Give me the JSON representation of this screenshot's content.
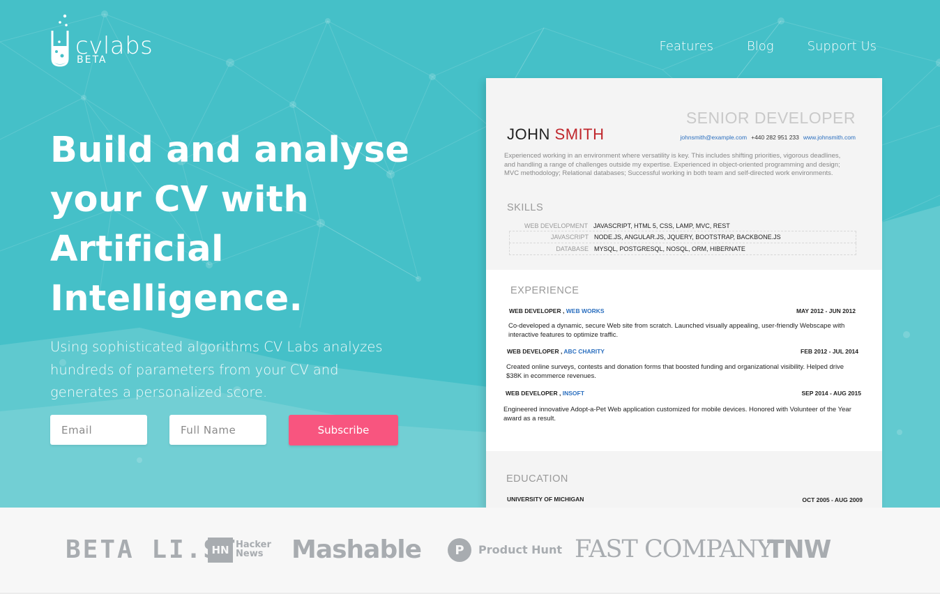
{
  "brand": {
    "name": "cvlabs",
    "badge": "BETA"
  },
  "nav": {
    "items": [
      "Features",
      "Blog",
      "Support Us"
    ]
  },
  "hero": {
    "headline": "Build and analyse your CV with Artificial Intelligence.",
    "subtext": "Using sophisticated algorithms CV Labs analyzes hundreds of parameters from your CV and generates a personalized score.",
    "form": {
      "email_placeholder": "Email",
      "name_placeholder": "Full Name",
      "submit_label": "Subscribe"
    }
  },
  "cv": {
    "role": "SENIOR DEVELOPER",
    "first_name": "JOHN",
    "last_name": "SMITH",
    "email": "johnsmith@example.com",
    "phone": "+440 282 951 233",
    "website": "www.johnsmith.com",
    "summary": "Experienced working in an environment where versatility is key. This includes shifting priorities, vigorous deadlines, and handling a range of challenges outside my expertise. Experienced in object-oriented programming and design; MVC methodology; Relational databases; Successful working in both team and self-directed work environments.",
    "skills_title": "SKILLS",
    "skills": [
      {
        "category": "WEB DEVELOPMENT",
        "items": "JAVASCRIPT, HTML 5, CSS, LAMP, MVC, REST"
      },
      {
        "category": "JAVASCRIPT",
        "items": "NODE.JS, ANGULAR.JS, JQUERY, BOOTSTRAP, BACKBONE.JS"
      },
      {
        "category": "DATABASE",
        "items": "MYSQL, POSTGRESQL, NOSQL, ORM, HIBERNATE"
      }
    ],
    "experience_title": "EXPERIENCE",
    "jobs": [
      {
        "title": "WEB DEVELOPER",
        "sep": ",",
        "company": "WEB WORKS",
        "dates": "MAY 2012 - JUN 2012",
        "desc": "Co-developed a dynamic, secure Web site from scratch. Launched visually appealing, user-friendly Webscape with interactive features to optimize traffic."
      },
      {
        "title": "WEB DEVELOPER",
        "sep": ",",
        "company": "ABC CHARITY",
        "dates": "FEB 2012 - JUL 2014",
        "desc": "Created online surveys, contests and donation forms that boosted funding and organizational visibility. Helped drive $38K in ecommerce revenues."
      },
      {
        "title": "WEB DEVELOPER",
        "sep": ",",
        "company": "INSOFT",
        "dates": "SEP 2014 - AUG 2015",
        "desc": "Engineered innovative Adopt-a-Pet Web application customized for mobile devices. Honored with Volunteer of the Year award as a result."
      }
    ],
    "education_title": "EDUCATION",
    "education": {
      "school": "UNIVERSITY OF MICHIGAN",
      "dates": "OCT 2005 - AUG 2009"
    }
  },
  "press": {
    "betalist": "BETA LI.ST",
    "hn_mark": "HN",
    "hn_line1": "Hacker",
    "hn_line2": "News",
    "mashable": "Mashable",
    "ph_mark": "P",
    "producthunt": "Product Hunt",
    "fastcompany": "FAST COMPANY",
    "tnw": "TNW"
  },
  "colors": {
    "hero_bg": "#45c0c8",
    "accent": "#f8557f",
    "cv_name_accent": "#c0262c",
    "cv_link": "#2b6fbf"
  }
}
